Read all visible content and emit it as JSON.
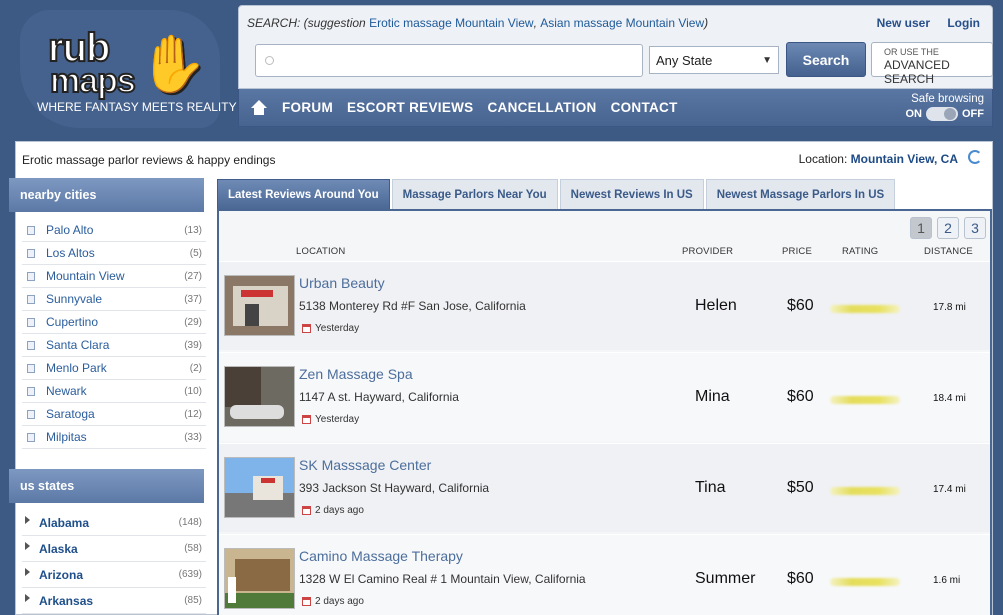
{
  "brand": {
    "logo_top": "rub",
    "logo_bottom": "maps",
    "tagline": "WHERE FANTASY MEETS REALITY"
  },
  "search": {
    "suggestion_prefix": "SEARCH: (suggestion ",
    "suggestion_1": "Erotic massage Mountain View",
    "suggestion_sep": ", ",
    "suggestion_2": "Asian massage Mountain View",
    "suggestion_suffix": ")",
    "input_value": "",
    "state_selected": "Any State",
    "button": "Search",
    "advanced_small": "OR USE THE",
    "advanced_big": "ADVANCED SEARCH"
  },
  "user_links": {
    "new_user": "New user",
    "login": "Login"
  },
  "nav": {
    "items": [
      "FORUM",
      "ESCORT REVIEWS",
      "CANCELLATION",
      "CONTACT"
    ]
  },
  "safe_browsing": {
    "label": "Safe browsing",
    "on": "ON",
    "off": "OFF"
  },
  "main": {
    "title": "Erotic massage parlor reviews & happy endings",
    "location_label": "Location: ",
    "location_value": "Mountain View, CA"
  },
  "sidebar": {
    "cities_title": "nearby cities",
    "cities": [
      {
        "name": "Palo Alto",
        "count": "(13)"
      },
      {
        "name": "Los Altos",
        "count": "(5)"
      },
      {
        "name": "Mountain View",
        "count": "(27)"
      },
      {
        "name": "Sunnyvale",
        "count": "(37)"
      },
      {
        "name": "Cupertino",
        "count": "(29)"
      },
      {
        "name": "Santa Clara",
        "count": "(39)"
      },
      {
        "name": "Menlo Park",
        "count": "(2)"
      },
      {
        "name": "Newark",
        "count": "(10)"
      },
      {
        "name": "Saratoga",
        "count": "(12)"
      },
      {
        "name": "Milpitas",
        "count": "(33)"
      }
    ],
    "states_title": "us states",
    "states": [
      {
        "name": "Alabama",
        "count": "(148)"
      },
      {
        "name": "Alaska",
        "count": "(58)"
      },
      {
        "name": "Arizona",
        "count": "(639)"
      },
      {
        "name": "Arkansas",
        "count": "(85)"
      }
    ]
  },
  "tabs": [
    "Latest Reviews Around You",
    "Massage Parlors Near You",
    "Newest Reviews In US",
    "Newest Massage Parlors In US"
  ],
  "pager": [
    "1",
    "2",
    "3"
  ],
  "columns": {
    "location": "LOCATION",
    "provider": "PROVIDER",
    "price": "PRICE",
    "rating": "RATING",
    "distance": "DISTANCE"
  },
  "reviews": [
    {
      "name": "Urban Beauty",
      "address": "5138 Monterey Rd #F San Jose, California",
      "date": "Yesterday",
      "provider": "Helen",
      "price": "$60",
      "distance": "17.8 mi"
    },
    {
      "name": "Zen Massage Spa",
      "address": "1147 A st. Hayward, California",
      "date": "Yesterday",
      "provider": "Mina",
      "price": "$60",
      "distance": "18.4 mi"
    },
    {
      "name": "SK Masssage Center",
      "address": "393 Jackson St Hayward, California",
      "date": "2 days ago",
      "provider": "Tina",
      "price": "$50",
      "distance": "17.4 mi"
    },
    {
      "name": "Camino Massage Therapy",
      "address": "1328 W El Camino Real # 1 Mountain View, California",
      "date": "2 days ago",
      "provider": "Summer",
      "price": "$60",
      "distance": "1.6 mi"
    }
  ],
  "icons": {
    "search": "magnifier-icon",
    "home": "home-icon",
    "refresh": "refresh-icon",
    "calendar": "calendar-icon",
    "city": "document-icon",
    "state": "triangle-right-icon"
  },
  "colors": {
    "brand_blue": "#3d5a85",
    "link": "#2a5d9c",
    "tab_active": "#4a6794"
  }
}
